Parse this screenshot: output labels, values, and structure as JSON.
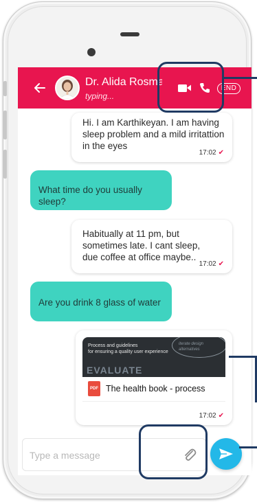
{
  "header": {
    "contact_name": "Dr. Alida Rosma",
    "status": "typing...",
    "end_label": "END",
    "color": "#e8154f"
  },
  "icons": {
    "back": "arrow-left-icon",
    "video": "video-camera-icon",
    "call": "phone-icon",
    "attach": "paperclip-icon",
    "send": "send-icon",
    "pdf": "pdf-file-icon"
  },
  "messages": [
    {
      "direction": "in",
      "text": "Hi. I am Karthikeyan. I am having sleep problem and a mild irritattion in the eyes",
      "time": "17:02",
      "status": "read"
    },
    {
      "direction": "out",
      "text": "What time do you usually sleep?"
    },
    {
      "direction": "in",
      "text": "Habitually at 11 pm, but sometimes late. I cant sleep, due coffee at office maybe..",
      "time": "17:02",
      "status": "read"
    },
    {
      "direction": "out",
      "text": "Are you drink 8 glass of water"
    },
    {
      "direction": "in",
      "type": "file",
      "preview_line1": "Process and guidelines",
      "preview_line2": "for ensuring a quality user experience",
      "preview_word1": "EVALUATE",
      "preview_word2": "iterate design alternatives",
      "file_name": "The health book - process",
      "time": "17:02",
      "status": "read"
    }
  ],
  "composer": {
    "placeholder": "Type a message"
  },
  "colors": {
    "outgoing_bubble": "#3fd3c0",
    "send_button": "#23b8e8",
    "annotation": "#1f3a63"
  }
}
